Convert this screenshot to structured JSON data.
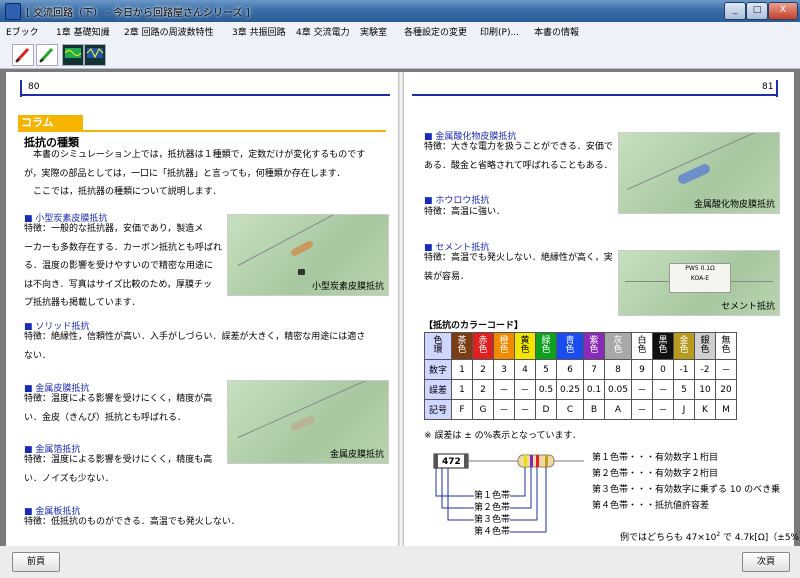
{
  "window": {
    "title": "[ 交流回路（下） - 今日から回路屋さんシリーズ ]",
    "minimize": "_",
    "maximize": "□",
    "close": "X"
  },
  "menu": {
    "items": [
      "Eブック",
      "1章 基礎知識",
      "2章 回路の周波数特性",
      "3章 共振回路",
      "4章 交流電力",
      "実験室",
      "各種設定の変更",
      "印刷(P)...",
      "本書の情報"
    ]
  },
  "toolbar": {
    "icons": [
      "pen-red-icon",
      "pen-green-icon",
      "wave-a-icon",
      "wave-b-icon"
    ]
  },
  "left_page": {
    "page_number": "80",
    "column_label": "コラム",
    "heading": "抵抗の種類",
    "intro": [
      "　本書のシミュレーション上では，抵抗器は１種類で，定数だけが変化するものです",
      "が，実際の部品としては，一口に「抵抗器」と言っても，何種類か存在します．",
      "　ここでは，抵抗器の種類について説明します．"
    ],
    "sections": [
      {
        "title": "小型炭素皮膜抵抗",
        "lines": [
          "特徴：一般的な抵抗器，安価であり，製造メ",
          "ーカーも多数存在する．カーボン抵抗とも呼ばれ",
          "る．温度の影響を受けやすいので精密な用途に",
          "は不向き．写真はサイズ比較のため，厚膜チッ",
          "プ抵抗器も掲載しています．"
        ],
        "photo_caption": "小型炭素皮膜抵抗"
      },
      {
        "title": "ソリッド抵抗",
        "lines": [
          "特徴：絶縁性，信頼性が高い．入手がしづらい．誤差が大きく，精密な用途には適さ",
          "ない．"
        ]
      },
      {
        "title": "金属皮膜抵抗",
        "lines": [
          "特徴：温度による影響を受けにくく，精度が高",
          "い．金皮（きんぴ）抵抗とも呼ばれる．"
        ],
        "photo_caption": "金属皮膜抵抗"
      },
      {
        "title": "金属箔抵抗",
        "lines": [
          "特徴：温度による影響を受けにくく，精度も高",
          "い．ノイズも少ない．"
        ]
      },
      {
        "title": "金属板抵抗",
        "lines": [
          "特徴：低抵抗のものができる．高温でも発火しない．"
        ]
      }
    ]
  },
  "right_page": {
    "page_number": "81",
    "sections": [
      {
        "title": "金属酸化物皮膜抵抗",
        "lines": [
          "特徴：大きな電力を扱うことができる．安価で",
          "ある．酸金と省略されて呼ばれることもある．"
        ],
        "photo_caption": "金属酸化物皮膜抵抗"
      },
      {
        "title": "ホウロウ抵抗",
        "lines": [
          "特徴：高温に強い．"
        ]
      },
      {
        "title": "セメント抵抗",
        "lines": [
          "特徴：高温でも発火しない．絶縁性が高く，実",
          "装が容易．"
        ],
        "photo_caption": "セメント抵抗",
        "photo_marking": "PW5 0.1Ω\nKOA-E"
      }
    ],
    "color_code": {
      "title": "【抵抗のカラーコード】",
      "row_headers": [
        "色\n環",
        "数字",
        "誤差",
        "記号"
      ],
      "colors": [
        {
          "name": "茶\n色",
          "bg": "#7a3e16",
          "fg": "#fff",
          "digit": "1",
          "tol": "1",
          "sym": "F"
        },
        {
          "name": "赤\n色",
          "bg": "#e02020",
          "fg": "#fff",
          "digit": "2",
          "tol": "2",
          "sym": "G"
        },
        {
          "name": "橙\n色",
          "bg": "#f08a00",
          "fg": "#fff",
          "digit": "3",
          "tol": "－",
          "sym": "－"
        },
        {
          "name": "黄\n色",
          "bg": "#f2e600",
          "fg": "#000",
          "digit": "4",
          "tol": "－",
          "sym": "－"
        },
        {
          "name": "緑\n色",
          "bg": "#10a020",
          "fg": "#fff",
          "digit": "5",
          "tol": "0.5",
          "sym": "D"
        },
        {
          "name": "青\n色",
          "bg": "#1a4cf0",
          "fg": "#fff",
          "digit": "6",
          "tol": "0.25",
          "sym": "C"
        },
        {
          "name": "紫\n色",
          "bg": "#8a2ab8",
          "fg": "#fff",
          "digit": "7",
          "tol": "0.1",
          "sym": "B"
        },
        {
          "name": "灰\n色",
          "bg": "#a8a8a8",
          "fg": "#fff",
          "digit": "8",
          "tol": "0.05",
          "sym": "A"
        },
        {
          "name": "白\n色",
          "bg": "#ffffff",
          "fg": "#000",
          "digit": "9",
          "tol": "－",
          "sym": "－"
        },
        {
          "name": "黒\n色",
          "bg": "#111111",
          "fg": "#fff",
          "digit": "0",
          "tol": "－",
          "sym": "－"
        },
        {
          "name": "金\n色",
          "bg": "#b89a20",
          "fg": "#fff",
          "digit": "-1",
          "tol": "5",
          "sym": "J"
        },
        {
          "name": "銀\n色",
          "bg": "#cfcfcf",
          "fg": "#000",
          "digit": "-2",
          "tol": "10",
          "sym": "K"
        },
        {
          "name": "無\n色",
          "bg": "#ffffff",
          "fg": "#000",
          "digit": "－",
          "tol": "20",
          "sym": "M"
        }
      ],
      "note": "※ 誤差は ± の%表示となっています．",
      "diagram_label": "472",
      "band_labels": [
        "第１色帯",
        "第２色帯",
        "第３色帯",
        "第４色帯"
      ],
      "band_desc": [
        "第１色帯・・・有効数字１桁目",
        "第２色帯・・・有効数字２桁目",
        "第３色帯・・・有効数字に乗ずる 10 のべき乗",
        "第４色帯・・・抵抗値許容差"
      ],
      "example_prefix": "例ではどちらも 47×10",
      "example_exp": "2",
      "example_suffix": " で 4.7k[Ω]（±5%）"
    }
  },
  "nav": {
    "prev": "前頁",
    "next": "次頁"
  }
}
